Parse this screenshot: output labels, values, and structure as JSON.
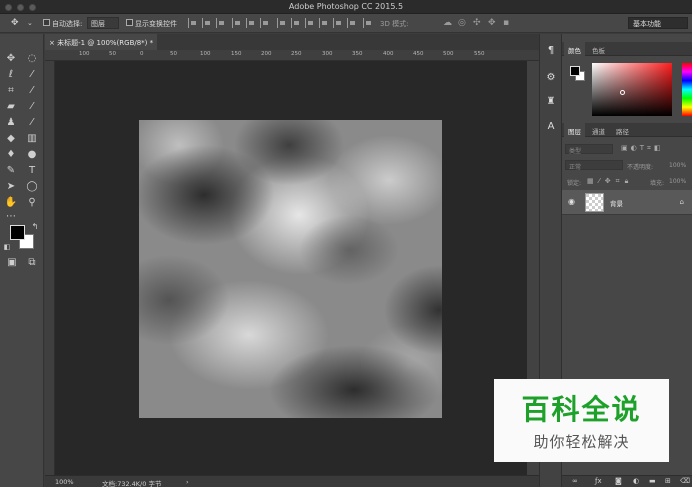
{
  "app": {
    "title": "Adobe Photoshop CC 2015.5"
  },
  "options_bar": {
    "auto_select_label": "自动选择:",
    "auto_select_target": "图层",
    "show_transform_label": "显示变换控件",
    "mode_3d_label": "3D 模式:",
    "workspace": "基本功能"
  },
  "document": {
    "tab_title": "未标题-1 @ 100%(RGB/8*) *",
    "close_glyph": "×",
    "ruler_labels": [
      "100",
      "50",
      "0",
      "50",
      "100",
      "150",
      "200",
      "250",
      "300",
      "350",
      "400",
      "450",
      "500",
      "550"
    ]
  },
  "status_bar": {
    "zoom": "100%",
    "doc_info": "文档:732.4K/0 字节",
    "arrow": "›"
  },
  "panels": {
    "color_tabs": [
      "颜色",
      "色板"
    ],
    "layer_tabs": [
      "图层",
      "通道",
      "路径"
    ],
    "layer_search_placeholder": "类型",
    "blend_mode": "正常",
    "opacity_label": "不透明度:",
    "opacity_value": "100%",
    "lock_label": "锁定:",
    "fill_label": "填充:",
    "fill_value": "100%",
    "layers": [
      {
        "name": "背景",
        "visible": true,
        "locked": true
      }
    ]
  },
  "watermark": {
    "title": "百科全说",
    "subtitle": "助你轻松解决"
  }
}
